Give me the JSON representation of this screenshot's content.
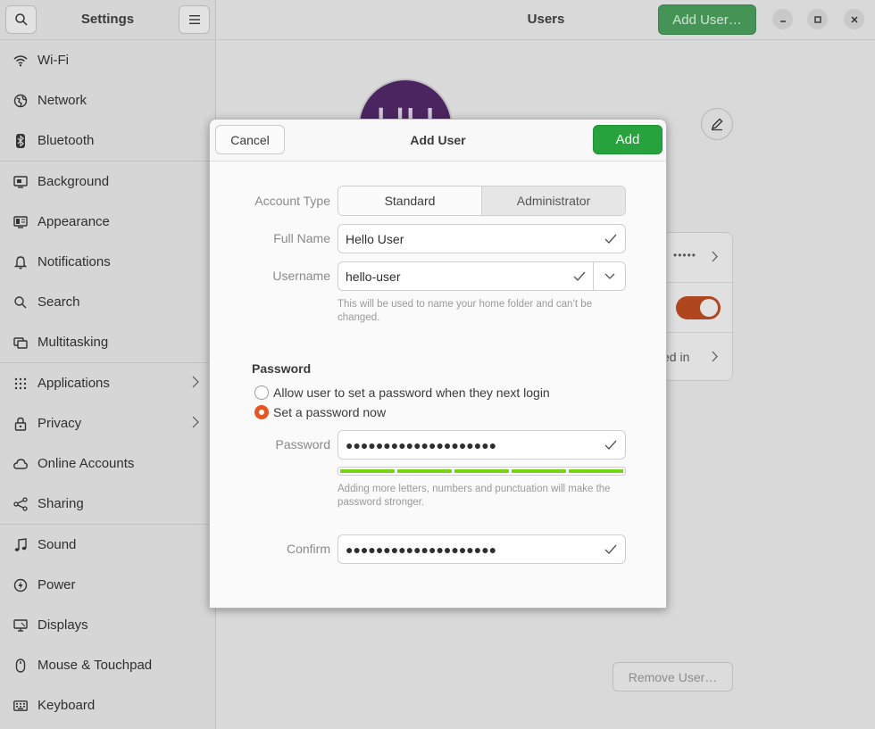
{
  "sidebar": {
    "title": "Settings",
    "items": [
      {
        "label": "Wi-Fi",
        "icon": "wifi-icon"
      },
      {
        "label": "Network",
        "icon": "network-icon"
      },
      {
        "label": "Bluetooth",
        "icon": "bluetooth-icon"
      },
      {
        "label": "Background",
        "icon": "background-icon"
      },
      {
        "label": "Appearance",
        "icon": "appearance-icon"
      },
      {
        "label": "Notifications",
        "icon": "bell-icon"
      },
      {
        "label": "Search",
        "icon": "search-icon"
      },
      {
        "label": "Multitasking",
        "icon": "multitasking-icon"
      },
      {
        "label": "Applications",
        "icon": "grid-icon"
      },
      {
        "label": "Privacy",
        "icon": "lock-icon"
      },
      {
        "label": "Online Accounts",
        "icon": "cloud-icon"
      },
      {
        "label": "Sharing",
        "icon": "share-icon"
      },
      {
        "label": "Sound",
        "icon": "music-note-icon"
      },
      {
        "label": "Power",
        "icon": "power-icon"
      },
      {
        "label": "Displays",
        "icon": "display-icon"
      },
      {
        "label": "Mouse & Touchpad",
        "icon": "mouse-icon"
      },
      {
        "label": "Keyboard",
        "icon": "keyboard-icon"
      }
    ]
  },
  "header": {
    "title": "Users",
    "add_user_label": "Add User…"
  },
  "background": {
    "avatar_initials": "HU",
    "password_dots": "•••••",
    "logged_in_text": "ed in",
    "remove_user_label": "Remove User…",
    "toggle_on": true
  },
  "dialog": {
    "title": "Add User",
    "cancel_label": "Cancel",
    "add_label": "Add",
    "account_type_label": "Account Type",
    "account_type_options": [
      "Standard",
      "Administrator"
    ],
    "account_type_selected": "Administrator",
    "full_name_label": "Full Name",
    "full_name_value": "Hello User",
    "username_label": "Username",
    "username_value": "hello-user",
    "username_hint": "This will be used to name your home folder and can’t be changed.",
    "password_section": "Password",
    "radio_next_login": "Allow user to set a password when they next login",
    "radio_set_now": "Set a password now",
    "password_label": "Password",
    "password_value": "●●●●●●●●●●●●●●●●●●●●",
    "strength_level": 1.0,
    "strength_hint": "Adding more letters, numbers and punctuation will make the password stronger.",
    "confirm_label": "Confirm",
    "confirm_value": "●●●●●●●●●●●●●●●●●●●●"
  },
  "colors": {
    "accent_green": "#26a33c",
    "radio_orange": "#e95420",
    "strength_green": "#73d216"
  }
}
